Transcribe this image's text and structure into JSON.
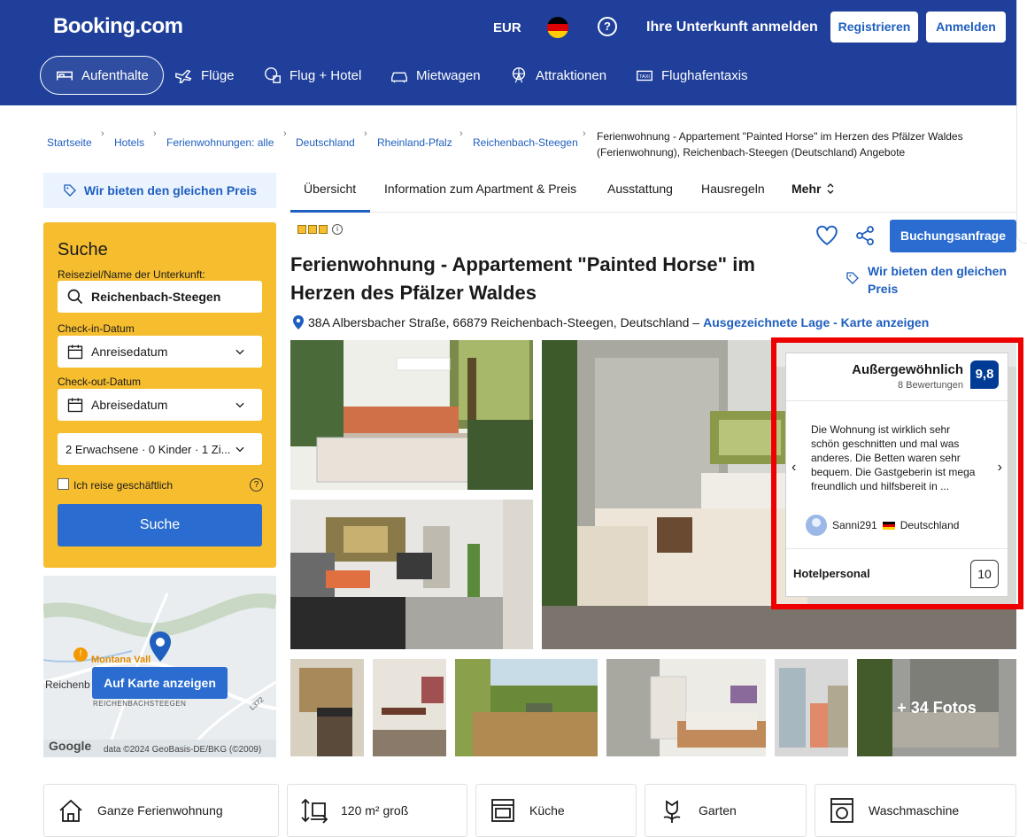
{
  "header": {
    "logo": "Booking.com",
    "currency": "EUR",
    "help_symbol": "?",
    "list_property": "Ihre Unterkunft anmelden",
    "register": "Registrieren",
    "login": "Anmelden",
    "colors": {
      "header_bg": "#1f3f9a",
      "accent": "#2a6ccf"
    }
  },
  "nav": [
    {
      "label": "Aufenthalte",
      "icon": "bed-icon",
      "active": true
    },
    {
      "label": "Flüge",
      "icon": "plane-icon"
    },
    {
      "label": "Flug + Hotel",
      "icon": "flight-hotel-icon"
    },
    {
      "label": "Mietwagen",
      "icon": "car-icon"
    },
    {
      "label": "Attraktionen",
      "icon": "ferris-wheel-icon"
    },
    {
      "label": "Flughafentaxis",
      "icon": "taxi-icon"
    }
  ],
  "breadcrumb": [
    "Startseite",
    "Hotels",
    "Ferienwohnungen: alle",
    "Deutschland",
    "Rheinland-Pfalz",
    "Reichenbach-Steegen"
  ],
  "breadcrumb_current": "Ferienwohnung - Appartement \"Painted Horse\" im Herzen des Pfälzer Waldes (Ferienwohnung), Reichenbach-Steegen (Deutschland) Angebote",
  "sidebar": {
    "price_match": "Wir bieten den gleichen Preis",
    "search": {
      "title": "Suche",
      "dest_label": "Reiseziel/Name der Unterkunft:",
      "dest_value": "Reichenbach-Steegen",
      "checkin_label": "Check-in-Datum",
      "checkin_value": "Anreisedatum",
      "checkout_label": "Check-out-Datum",
      "checkout_value": "Abreisedatum",
      "guests": "2 Erwachsene · 0 Kinder · 1 Zi...",
      "business_trip": "Ich reise geschäftlich",
      "help_symbol": "?",
      "button": "Suche"
    },
    "map": {
      "button": "Auf Karte anzeigen",
      "place1": "Montana Vall",
      "place2": "Reichenb",
      "place3": "REICHENBACHSTEEGEN",
      "road": "L372",
      "attribution": "data ©2024 GeoBasis-DE/BKG (©2009)",
      "google": "Google"
    }
  },
  "tabs": [
    "Übersicht",
    "Information zum Apartment & Preis",
    "Ausstattung",
    "Hausregeln",
    "Mehr"
  ],
  "property": {
    "stars": 3,
    "info_symbol": "i",
    "title": "Ferienwohnung - Appartement \"Painted Horse\" im Herzen des Pfälzer Waldes",
    "address": "38A Albersbacher Straße, 66879 Reichenbach-Steegen, Deutschland –",
    "address_link": "Ausgezeichnete Lage - Karte anzeigen",
    "book_button": "Buchungsanfrage",
    "price_match": "Wir bieten den gleichen Preis",
    "more_photos": "+ 34 Fotos"
  },
  "review": {
    "word": "Außergewöhnlich",
    "count": "8 Bewertungen",
    "score": "9,8",
    "text": "Die Wohnung ist wirklich sehr schön geschnitten und mal was anderes. Die Betten waren sehr bequem. Die Gastgeberin ist mega freundlich und hilfsbereit in ...",
    "user": "Sanni291",
    "country": "Deutschland",
    "staff_label": "Hotelpersonal",
    "staff_score": "10",
    "prev": "‹",
    "next": "›"
  },
  "facilities": [
    {
      "label": "Ganze Ferienwohnung",
      "icon": "house-icon"
    },
    {
      "label": "120 m² groß",
      "icon": "size-icon"
    },
    {
      "label": "Küche",
      "icon": "oven-icon"
    },
    {
      "label": "Garten",
      "icon": "flower-icon"
    },
    {
      "label": "Waschmaschine",
      "icon": "washing-machine-icon"
    }
  ]
}
